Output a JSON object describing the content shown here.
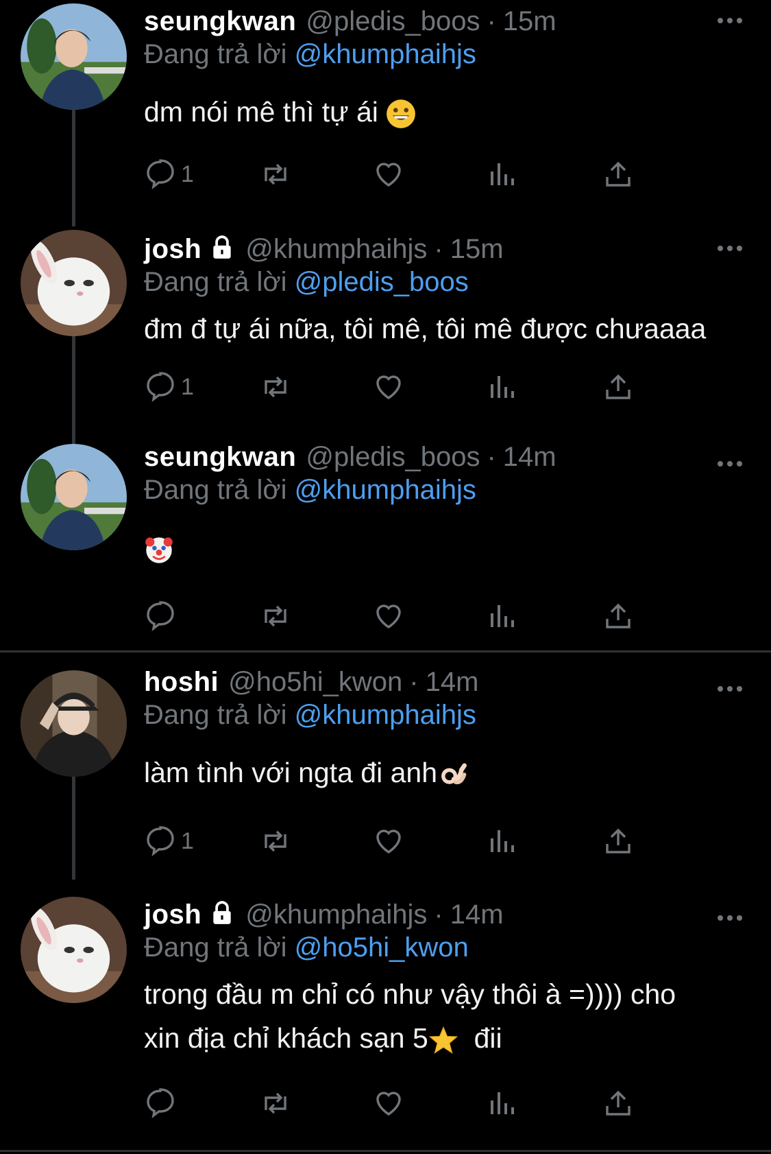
{
  "labels": {
    "replying_to": "Đang trả lời"
  },
  "colors": {
    "background": "#000000",
    "mention": "#4d9ff0",
    "muted": "#71767b",
    "text": "#e7e9ea"
  },
  "posts": [
    {
      "name": "seungkwan",
      "handle": "@pledis_boos",
      "separator": "·",
      "time": "15m",
      "reply_to": "@khumphaihjs",
      "text": "dm nói mê thì tự ái",
      "emoji": "grinning-face",
      "reply_count": "1",
      "locked": false,
      "avatar": "person-avatar"
    },
    {
      "name": "josh",
      "handle": "@khumphaihjs",
      "separator": "·",
      "time": "15m",
      "reply_to": "@pledis_boos",
      "text": "đm đ tự ái nữa, tôi mê, tôi mê được chưaaaa",
      "emoji": "",
      "reply_count": "1",
      "locked": true,
      "avatar": "white-rabbit-avatar"
    },
    {
      "name": "seungkwan",
      "handle": "@pledis_boos",
      "separator": "·",
      "time": "14m",
      "reply_to": "@khumphaihjs",
      "text": "",
      "emoji": "clown-face",
      "reply_count": "",
      "locked": false,
      "avatar": "person-avatar"
    },
    {
      "name": "hoshi",
      "handle": "@ho5hi_kwon",
      "separator": "·",
      "time": "14m",
      "reply_to": "@khumphaihjs",
      "text": "làm tình với ngta đi anh",
      "emoji": "ok-hand",
      "reply_count": "1",
      "locked": false,
      "avatar": "person-cap-avatar"
    },
    {
      "name": "josh",
      "handle": "@khumphaihjs",
      "separator": "·",
      "time": "14m",
      "reply_to": "@ho5hi_kwon",
      "text_line1": "trong đầu m chỉ có như vậy thôi à =)))) cho",
      "text_line2_a": "xin địa chỉ khách sạn 5",
      "text_line2_b": "đii",
      "emoji": "star",
      "reply_count": "",
      "locked": true,
      "avatar": "white-rabbit-avatar"
    }
  ]
}
